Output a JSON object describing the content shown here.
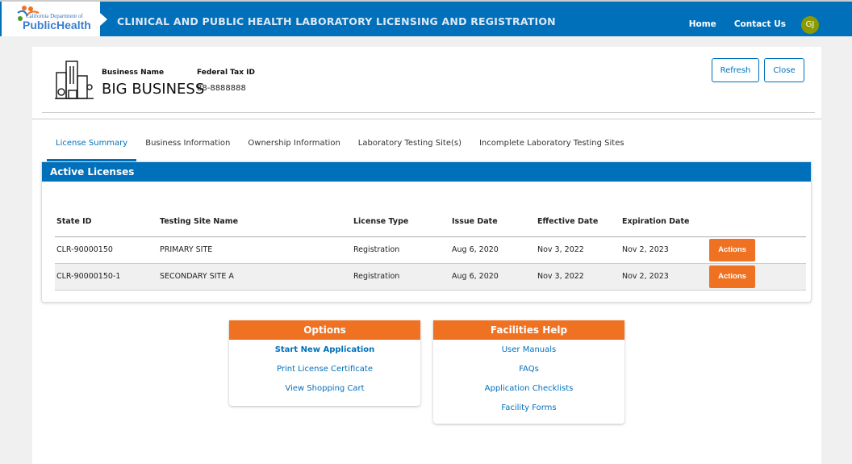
{
  "header": {
    "logo_line1": "California Department of",
    "logo_line2": "PublicHealth",
    "title": "CLINICAL AND PUBLIC HEALTH LABORATORY LICENSING AND REGISTRATION",
    "nav": [
      "Home",
      "Contact Us"
    ],
    "avatar": "GJ"
  },
  "business": {
    "name_label": "Business Name",
    "name": "BIG BUSINESS",
    "tax_label": "Federal Tax ID",
    "tax": "88-8888888",
    "refresh": "Refresh",
    "close": "Close"
  },
  "tabs": [
    "License Summary",
    "Business Information",
    "Ownership Information",
    "Laboratory Testing Site(s)",
    "Incomplete Laboratory Testing Sites"
  ],
  "licenses": {
    "title": "Active Licenses",
    "columns": [
      "State ID",
      "Testing Site Name",
      "License Type",
      "Issue Date",
      "Effective Date",
      "Expiration Date"
    ],
    "rows": [
      [
        "CLR-90000150",
        "PRIMARY SITE",
        "Registration",
        "Aug 6, 2020",
        "Nov 3, 2022",
        "Nov 2, 2023"
      ],
      [
        "CLR-90000150-1",
        "SECONDARY SITE A",
        "Registration",
        "Aug 6, 2020",
        "Nov 3, 2022",
        "Nov 2, 2023"
      ]
    ],
    "action_label": "Actions"
  },
  "options": {
    "title": "Options",
    "links": [
      "Start New Application",
      "Print License Certificate",
      "View Shopping Cart"
    ]
  },
  "help": {
    "title": "Facilities Help",
    "links": [
      "User Manuals",
      "FAQs",
      "Application Checklists",
      "Facility Forms"
    ]
  }
}
